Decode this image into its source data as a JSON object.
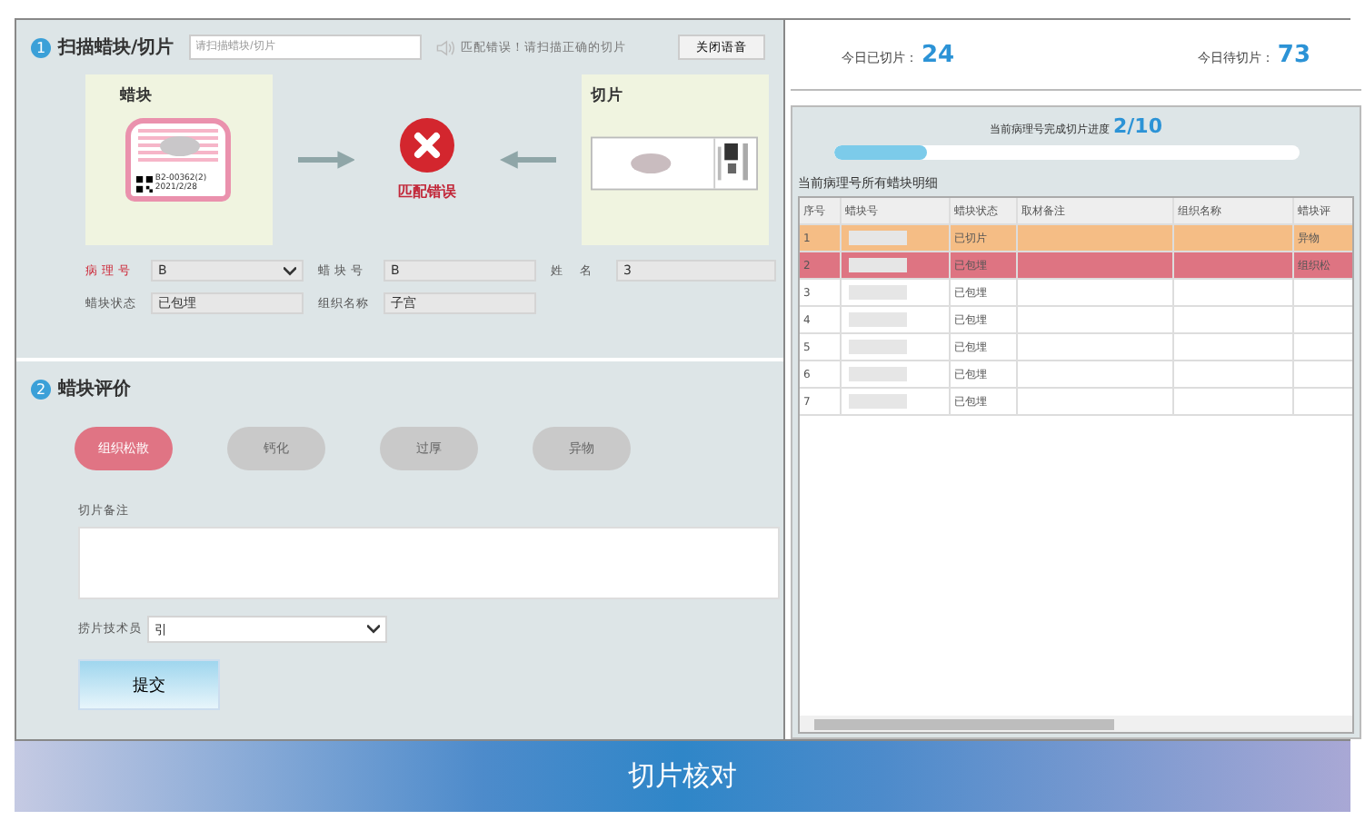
{
  "scan": {
    "step": "1",
    "title": "扫描蜡块/切片",
    "placeholder": "请扫描蜡块/切片",
    "message": "匹配错误！请扫描正确的切片",
    "mute_button": "关闭语音",
    "block_card": {
      "title": "蜡块",
      "code": "B2-00362(2)",
      "date": "2021/2/28"
    },
    "result": {
      "label": "匹配错误",
      "matched": false
    },
    "slide_card": {
      "title": "切片"
    },
    "fields": [
      {
        "label": "病 理 号",
        "value": "B",
        "kind": "select",
        "required": true
      },
      {
        "label": "蜡 块 号",
        "value": "B",
        "kind": "text",
        "required": false
      },
      {
        "label": "姓　 名",
        "value": "3",
        "kind": "text",
        "required": false
      },
      {
        "label": "蜡块状态",
        "value": "已包埋",
        "kind": "text",
        "required": false
      },
      {
        "label": "组织名称",
        "value": "子宫",
        "kind": "text",
        "required": false
      }
    ]
  },
  "evaluation": {
    "step": "2",
    "title": "蜡块评价",
    "options": [
      {
        "label": "组织松散",
        "selected": true
      },
      {
        "label": "钙化",
        "selected": false
      },
      {
        "label": "过厚",
        "selected": false
      },
      {
        "label": "异物",
        "selected": false
      }
    ],
    "note_label": "切片备注",
    "tech_label": "捞片技术员",
    "tech_value": "引",
    "submit": "提交"
  },
  "stats": [
    {
      "label": "今日已切片：",
      "value": "24"
    },
    {
      "label": "今日待切片：",
      "value": "73"
    }
  ],
  "progress": {
    "label": "当前病理号完成切片进度",
    "value": "2/10",
    "level": 0.2
  },
  "table": {
    "title": "当前病理号所有蜡块明细",
    "columns": [
      "序号",
      "蜡块号",
      "蜡块状态",
      "取材备注",
      "组织名称",
      "蜡块评"
    ],
    "rows": [
      {
        "index": "1",
        "status": "已切片",
        "evaluation": "异物",
        "color": "#f5bd85"
      },
      {
        "index": "2",
        "status": "已包埋",
        "evaluation": "组织松",
        "color": "#de7482"
      },
      {
        "index": "3",
        "status": "已包埋",
        "evaluation": "",
        "color": "#ffffff"
      },
      {
        "index": "4",
        "status": "已包埋",
        "evaluation": "",
        "color": "#ffffff"
      },
      {
        "index": "5",
        "status": "已包埋",
        "evaluation": "",
        "color": "#ffffff"
      },
      {
        "index": "6",
        "status": "已包埋",
        "evaluation": "",
        "color": "#ffffff"
      },
      {
        "index": "7",
        "status": "已包埋",
        "evaluation": "",
        "color": "#ffffff"
      }
    ]
  },
  "banner": {
    "title": "切片核对"
  }
}
